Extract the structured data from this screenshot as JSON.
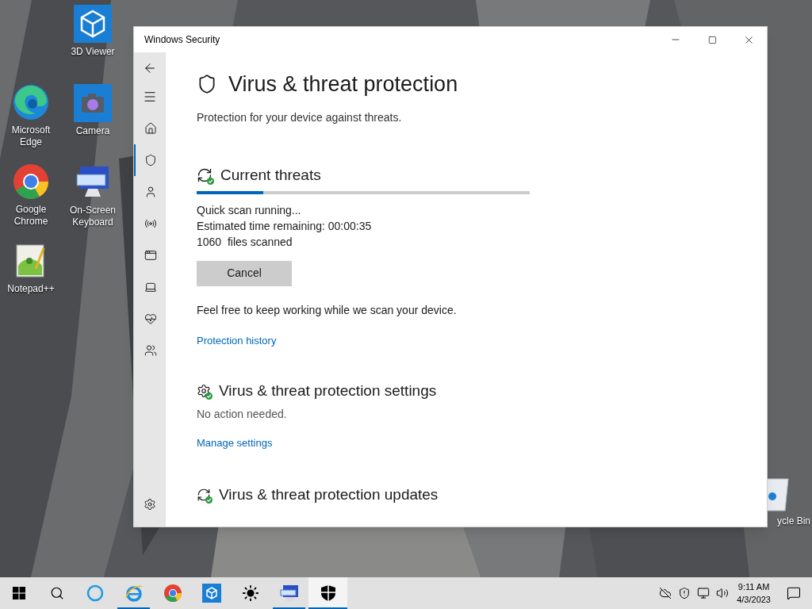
{
  "desktop_icons": [
    {
      "kind": "viewer3d",
      "label": "3D Viewer"
    },
    {
      "kind": "edge",
      "label": "Microsoft Edge"
    },
    {
      "kind": "camera",
      "label": "Camera"
    },
    {
      "kind": "chrome",
      "label": "Google Chrome"
    },
    {
      "kind": "keyboard",
      "label": "On-Screen Keyboard"
    },
    {
      "kind": "notepad",
      "label": "Notepad++"
    }
  ],
  "recycle_bin": {
    "label": "ycle Bin"
  },
  "window": {
    "title": "Windows Security",
    "nav": [
      {
        "kind": "home",
        "selected": false
      },
      {
        "kind": "shield",
        "selected": true
      },
      {
        "kind": "person",
        "selected": false
      },
      {
        "kind": "antenna",
        "selected": false
      },
      {
        "kind": "browser",
        "selected": false
      },
      {
        "kind": "laptop",
        "selected": false
      },
      {
        "kind": "heart",
        "selected": false
      },
      {
        "kind": "family",
        "selected": false
      }
    ],
    "heading": "Virus & threat protection",
    "subtitle": "Protection for your device against threats.",
    "current_threats": {
      "title": "Current threats",
      "level": 0.2,
      "lines": [
        "Quick scan running...",
        "Estimated time remaining: 00:00:35",
        "1060  files scanned"
      ],
      "button": "Cancel",
      "note": "Feel free to keep working while we scan your device.",
      "link": "Protection history"
    },
    "settings": {
      "title": "Virus & threat protection settings",
      "status": "No action needed.",
      "link": "Manage settings"
    },
    "updates": {
      "title": "Virus & threat protection updates"
    }
  },
  "taskbar": {
    "apps": [
      {
        "kind": "ie",
        "running": true,
        "active": false
      },
      {
        "kind": "chrome",
        "running": false,
        "active": false
      },
      {
        "kind": "viewer3d",
        "running": false,
        "active": false
      },
      {
        "kind": "sun",
        "running": false,
        "active": false
      },
      {
        "kind": "keyboard",
        "running": true,
        "active": false
      },
      {
        "kind": "security",
        "running": true,
        "active": true
      }
    ],
    "time": "9:11 AM",
    "date": "4/3/2023"
  }
}
